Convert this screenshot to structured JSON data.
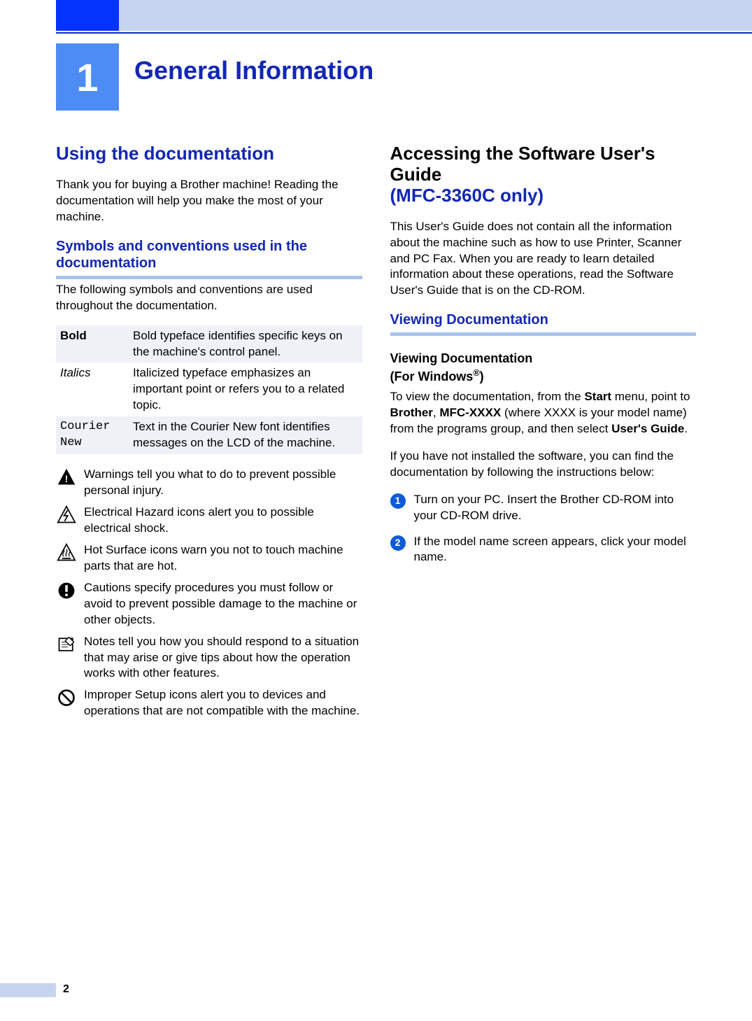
{
  "chapter": {
    "number": "1",
    "title": "General Information"
  },
  "left": {
    "h1": "Using the documentation",
    "intro": "Thank you for buying a Brother machine! Reading the documentation will help you make the most of your machine.",
    "h2": "Symbols and conventions used in the documentation",
    "conv_intro": "The following symbols and conventions are used throughout the documentation.",
    "conv": [
      {
        "key": "Bold",
        "val": "Bold typeface identifies specific keys on the machine's control panel."
      },
      {
        "key": "Italics",
        "val": "Italicized typeface emphasizes an important point or refers you to a related topic."
      },
      {
        "key": "Courier New",
        "val": "Text in the Courier New font identifies messages on the LCD of the machine."
      }
    ],
    "symbols": [
      "Warnings tell you what to do to prevent possible personal injury.",
      "Electrical Hazard icons alert you to possible electrical shock.",
      "Hot Surface icons warn you not to touch machine parts that are hot.",
      "Cautions specify procedures you must follow or avoid to prevent possible damage to the machine or other objects.",
      "Notes tell you how you should respond to a situation that may arise or give tips about how the operation works with other features.",
      "Improper Setup icons alert you to devices and operations that are not compatible with the machine."
    ]
  },
  "right": {
    "h1_line1": "Accessing the Software User's Guide",
    "h1_line2": "(MFC-3360C only)",
    "intro": "This User's Guide does not contain all the information about the machine such as how to use Printer, Scanner and PC Fax. When you are ready to learn detailed information about these operations, read the Software User's Guide that is on the CD-ROM.",
    "h2": "Viewing Documentation",
    "h3a": "Viewing Documentation",
    "h3b": "(For Windows",
    "h3c": ")",
    "reg": "®",
    "p1a": "To view the documentation, from the ",
    "p1b": "Start",
    "p1c": " menu, point to ",
    "p1d": "Brother",
    "p1e": ", ",
    "p1f": "MFC-XXXX",
    "p1g": " (where XXXX is your model name) from the programs group, and then select ",
    "p1h": "User's Guide",
    "p1i": ".",
    "p2": "If you have not installed the software, you can find the documentation by following the instructions below:",
    "steps": [
      "Turn on your PC. Insert the Brother CD-ROM into your CD-ROM drive.",
      "If the model name screen appears, click your model name."
    ],
    "step_nums": [
      "1",
      "2"
    ]
  },
  "page_number": "2"
}
